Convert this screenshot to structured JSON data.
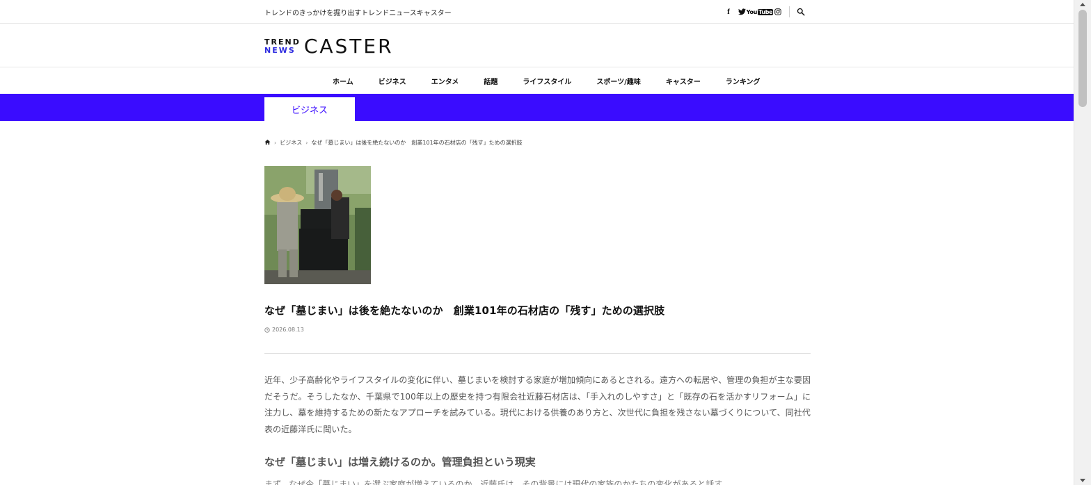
{
  "site": {
    "tagline": "トレンドのきっかけを掘り出すトレンドニュースキャスター",
    "logo_small_top": "TREND",
    "logo_small_bottom": "NEWS",
    "logo_main": "CASTER",
    "brand_color": "#3a0cff",
    "social_icons": [
      "facebook-icon",
      "twitter-icon",
      "youtube-icon",
      "instagram-icon"
    ],
    "youtube_you": "You",
    "youtube_tube": "Tube"
  },
  "nav": {
    "items": [
      {
        "label": "ホーム"
      },
      {
        "label": "ビジネス"
      },
      {
        "label": "エンタメ"
      },
      {
        "label": "話題"
      },
      {
        "label": "ライフスタイル"
      },
      {
        "label": "スポーツ/趣味"
      },
      {
        "label": "キャスター"
      },
      {
        "label": "ランキング"
      }
    ]
  },
  "category": {
    "active_tab": "ビジネス"
  },
  "breadcrumb": {
    "items": [
      {
        "label": "ビジネス"
      },
      {
        "label": "なぜ「墓じまい」は後を絶たないのか　創業101年の石材店の「残す」ための選択肢"
      }
    ]
  },
  "article": {
    "title": "なぜ「墓じまい」は後を絶たないのか　創業101年の石材店の「残す」ための選択肢",
    "date": "2026.08.13",
    "lead": "近年、少子高齢化やライフスタイルの変化に伴い、墓じまいを検討する家庭が増加傾向にあるとされる。遠方への転居や、管理の負担が主な要因だそうだ。そうしたなか、千葉県で100年以上の歴史を持つ有限会社近藤石材店は、「手入れのしやすさ」と「既存の石を活かすリフォーム」に注力し、墓を維持するための新たなアプローチを試みている。現代における供養のあり方と、次世代に負担を残さない墓づくりについて、同社代表の近藤洋氏に聞いた。",
    "heading_1": "なぜ「墓じまい」は増え続けるのか。管理負担という現実",
    "next_paragraph": "まず、なぜ今「墓じまい」を選ぶ家庭が増えているのか。近藤氏は、その背景には現代の家族のかたちの変化があると話す。"
  }
}
